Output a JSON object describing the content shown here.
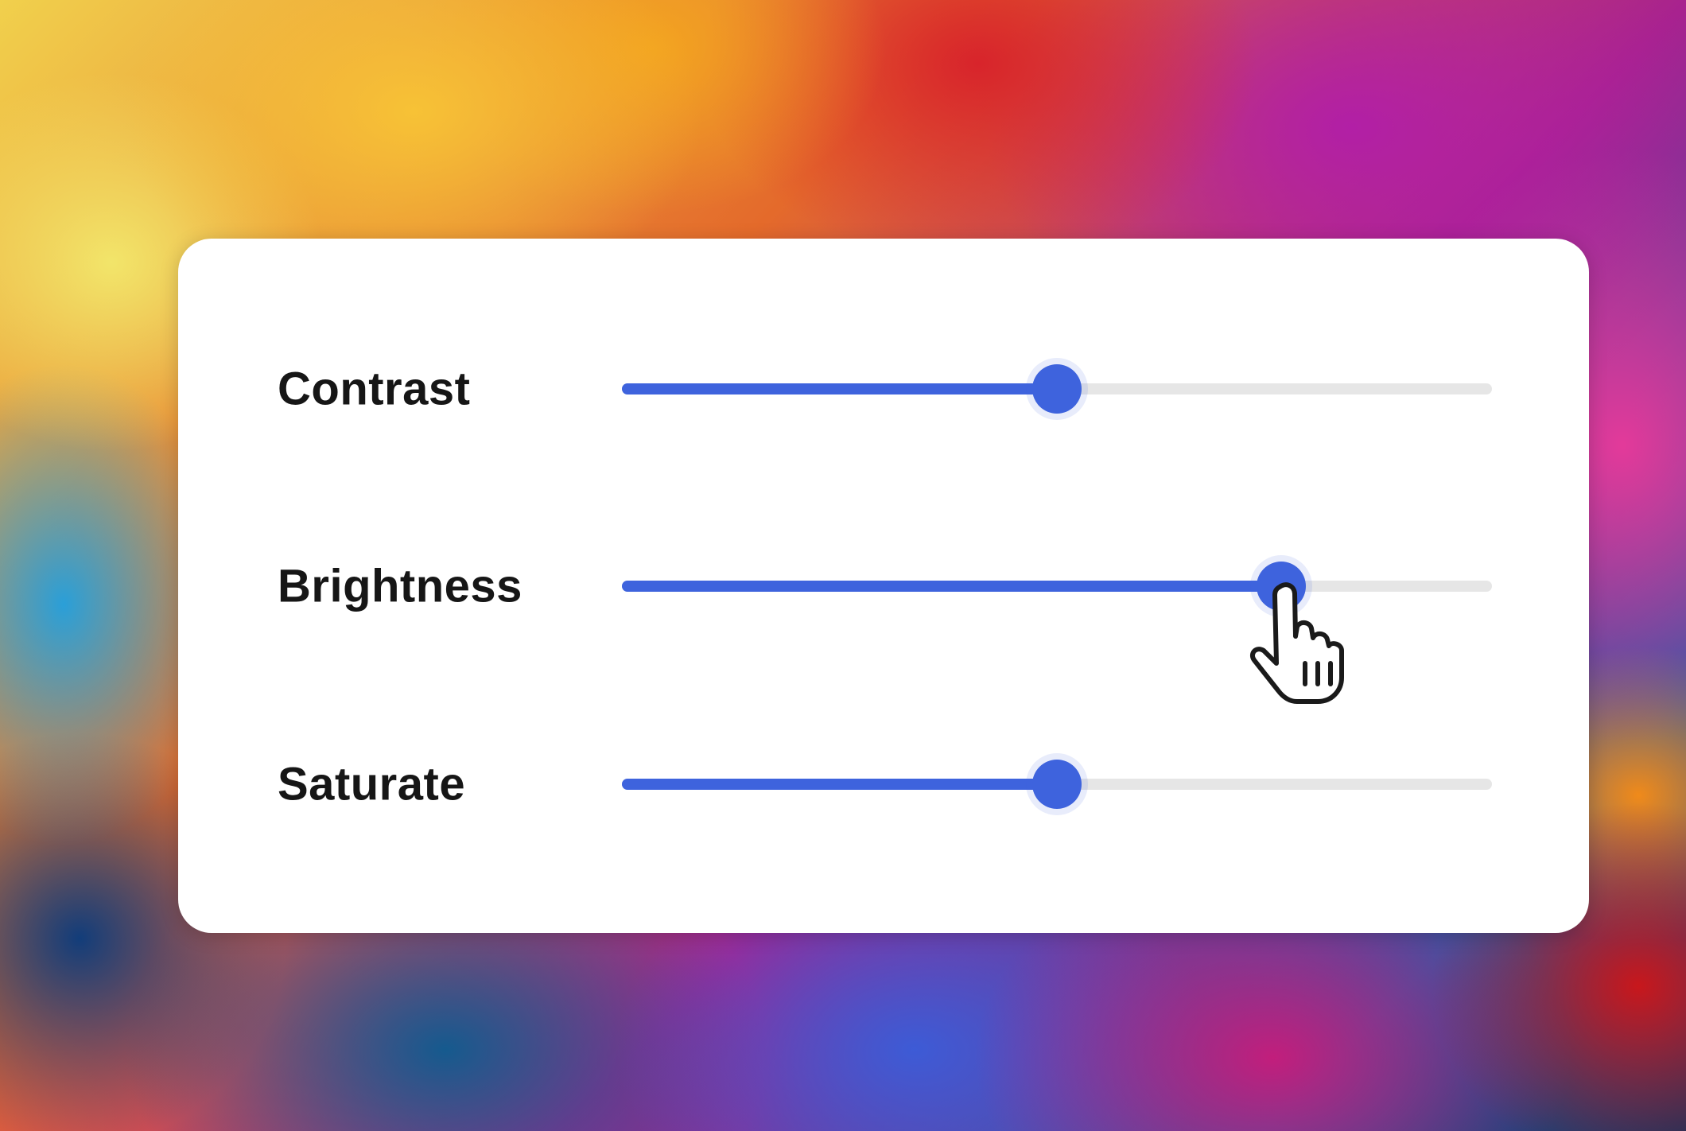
{
  "sliders": [
    {
      "label": "Contrast",
      "value": 0.5
    },
    {
      "label": "Brightness",
      "value": 0.758
    },
    {
      "label": "Saturate",
      "value": 0.5
    }
  ],
  "colors": {
    "accent": "#3e63dd",
    "track": "#e6e6e6",
    "panel": "#ffffff",
    "label": "#161616"
  },
  "cursor": {
    "icon": "hand-pointer-icon",
    "target": "Brightness"
  }
}
